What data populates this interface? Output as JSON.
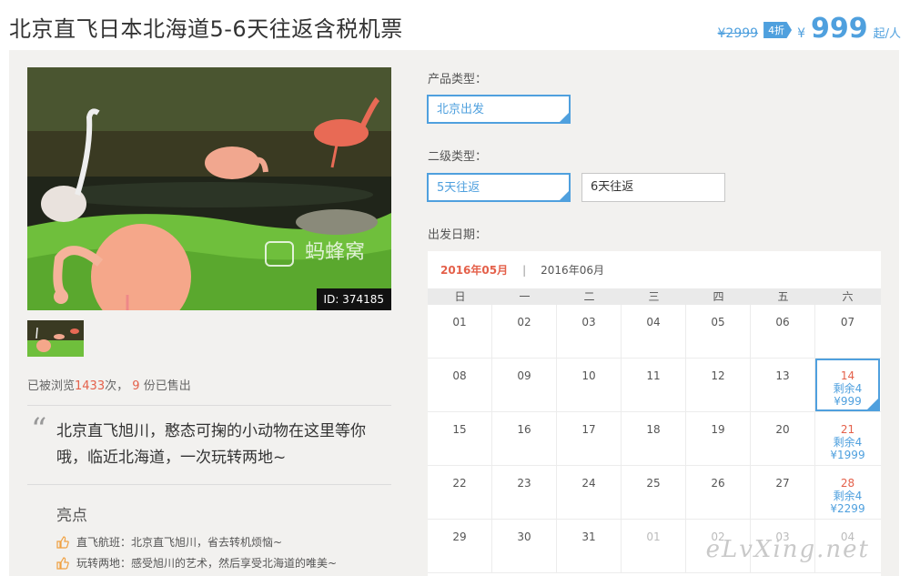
{
  "product": {
    "title": "北京直飞日本北海道5-6天往返含税机票",
    "original_price": "¥2999",
    "discount_badge": "4折",
    "currency": "¥",
    "price": "999",
    "unit": "起/人"
  },
  "gallery": {
    "photo_id": "ID: 374185",
    "brand_watermark": "蚂蜂窝"
  },
  "stats": {
    "prefix": "已被浏览",
    "views": "1433",
    "mid": "次，",
    "sold": "9",
    "suffix": "份已售出"
  },
  "description": {
    "quote": "“",
    "text": "北京直飞旭川，憨态可掬的小动物在这里等你哦，临近北海道，一次玩转两地~"
  },
  "highlights": {
    "title": "亮点",
    "items": [
      {
        "text": "直飞航班：北京直飞旭川，省去转机烦恼~"
      },
      {
        "text": "玩转两地：感受旭川的艺术，然后享受北海道的唯美~"
      }
    ]
  },
  "options": {
    "product_type_label": "产品类型：",
    "product_type_selected": "北京出发",
    "sub_type_label": "二级类型：",
    "sub_type_options": [
      "5天往返",
      "6天往返"
    ],
    "date_label": "出发日期："
  },
  "calendar": {
    "current_month": "2016年05月",
    "separator": "|",
    "next_month": "2016年06月",
    "weekdays": [
      "日",
      "一",
      "二",
      "三",
      "四",
      "五",
      "六"
    ],
    "rows": [
      [
        {
          "d": "01"
        },
        {
          "d": "02"
        },
        {
          "d": "03"
        },
        {
          "d": "04"
        },
        {
          "d": "05"
        },
        {
          "d": "06"
        },
        {
          "d": "07"
        }
      ],
      [
        {
          "d": "08"
        },
        {
          "d": "09"
        },
        {
          "d": "10"
        },
        {
          "d": "11"
        },
        {
          "d": "12"
        },
        {
          "d": "13"
        },
        {
          "d": "14",
          "rem": "剩余4",
          "price": "¥999",
          "selected": true
        }
      ],
      [
        {
          "d": "15"
        },
        {
          "d": "16"
        },
        {
          "d": "17"
        },
        {
          "d": "18"
        },
        {
          "d": "19"
        },
        {
          "d": "20"
        },
        {
          "d": "21",
          "rem": "剩余4",
          "price": "¥1999"
        }
      ],
      [
        {
          "d": "22"
        },
        {
          "d": "23"
        },
        {
          "d": "24"
        },
        {
          "d": "25"
        },
        {
          "d": "26"
        },
        {
          "d": "27"
        },
        {
          "d": "28",
          "rem": "剩余4",
          "price": "¥2299"
        }
      ],
      [
        {
          "d": "29"
        },
        {
          "d": "30"
        },
        {
          "d": "31"
        },
        {
          "d": "01",
          "muted": true
        },
        {
          "d": "02",
          "muted": true
        },
        {
          "d": "03",
          "muted": true
        },
        {
          "d": "04",
          "muted": true
        }
      ]
    ]
  },
  "watermark": "eLvXing.net",
  "colors": {
    "accent": "#4fa0de",
    "highlight": "#e4604a",
    "panel": "#f2f1ef"
  }
}
